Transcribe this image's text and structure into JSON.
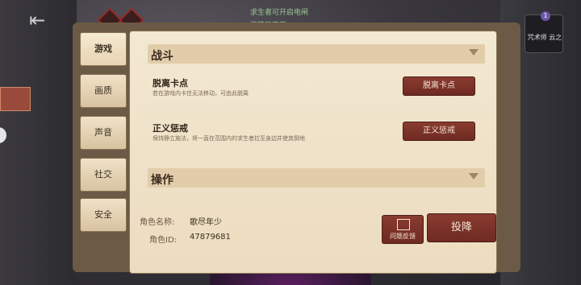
{
  "hud": {
    "messages": [
      "求生者可开启电闸",
      "监管已离开"
    ],
    "right_panel_label": "咒术师\n云之",
    "right_badge": "1"
  },
  "tabs": [
    {
      "label": "游戏",
      "active": true
    },
    {
      "label": "画质",
      "active": false
    },
    {
      "label": "声音",
      "active": false
    },
    {
      "label": "社交",
      "active": false
    },
    {
      "label": "安全",
      "active": false
    }
  ],
  "sections": {
    "combat": {
      "title": "战斗"
    },
    "controls": {
      "title": "操作"
    }
  },
  "rows": [
    {
      "title": "脱离卡点",
      "desc": "若在游戏内卡住无法移动，可由此脱离",
      "button": "脱离卡点"
    },
    {
      "title": "正义惩戒",
      "desc": "保持静立施法，将一直在范围内的求生者拉至身边并使其倒地",
      "button": "正义惩戒"
    }
  ],
  "footer": {
    "name_label": "角色名称:",
    "name_value": "歌尽年少",
    "id_label": "角色ID:",
    "id_value": "47879681",
    "feedback_label": "问题反馈",
    "surrender_label": "投降"
  },
  "colors": {
    "panel": "#f3e8d2",
    "accent_button": "#7a3026",
    "section_bar": "#e2cdaa"
  }
}
